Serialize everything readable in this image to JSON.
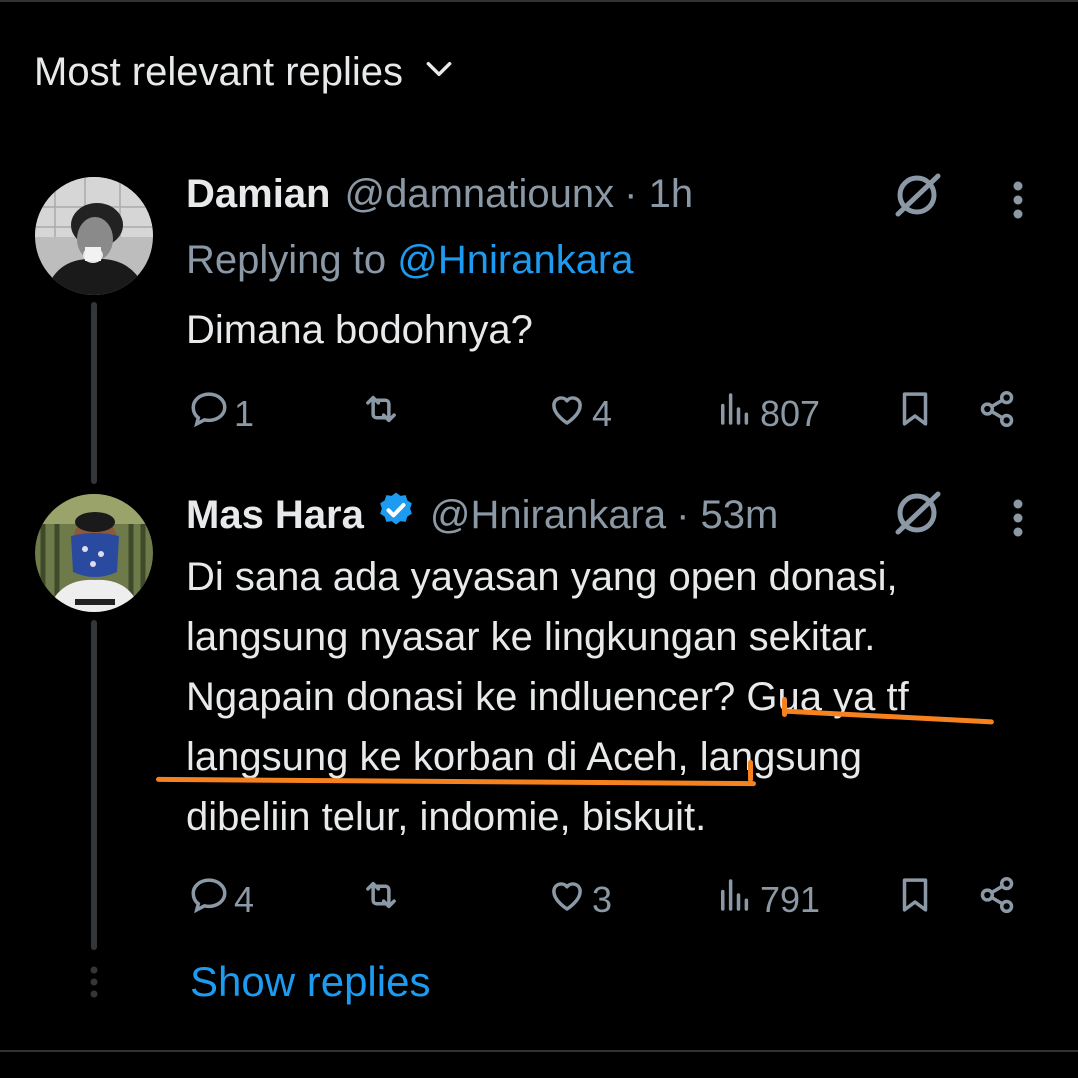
{
  "header": {
    "sort_label": "Most relevant replies"
  },
  "tweets": [
    {
      "name": "Damian",
      "handle": "@damnatiounx",
      "time": "· 1h",
      "replying_prefix": "Replying to",
      "replying_to": "@Hnirankara",
      "verified": false,
      "text_lines": [
        "Dimana bodohnya?"
      ],
      "stats": {
        "replies": "1",
        "retweets": "",
        "likes": "4",
        "views": "807"
      }
    },
    {
      "name": "Mas Hara",
      "handle": "@Hnirankara",
      "time": "· 53m",
      "verified": true,
      "text_lines": [
        "Di sana ada yayasan yang open donasi,",
        "langsung nyasar ke lingkungan sekitar.",
        "Ngapain donasi ke indluencer? Gua ya tf",
        "langsung ke korban di Aceh, langsung",
        "dibeliin telur, indomie, biskuit."
      ],
      "stats": {
        "replies": "4",
        "retweets": "",
        "likes": "3",
        "views": "791"
      }
    }
  ],
  "footer": {
    "show_replies": "Show replies"
  },
  "colors": {
    "accent": "#1d9bf0",
    "highlight": "#f5821f",
    "muted": "#8b98a5"
  },
  "icons": [
    "chevron-down-icon",
    "grok-icon",
    "more-icon",
    "reply-icon",
    "retweet-icon",
    "like-icon",
    "views-icon",
    "bookmark-icon",
    "share-icon",
    "verified-icon"
  ]
}
